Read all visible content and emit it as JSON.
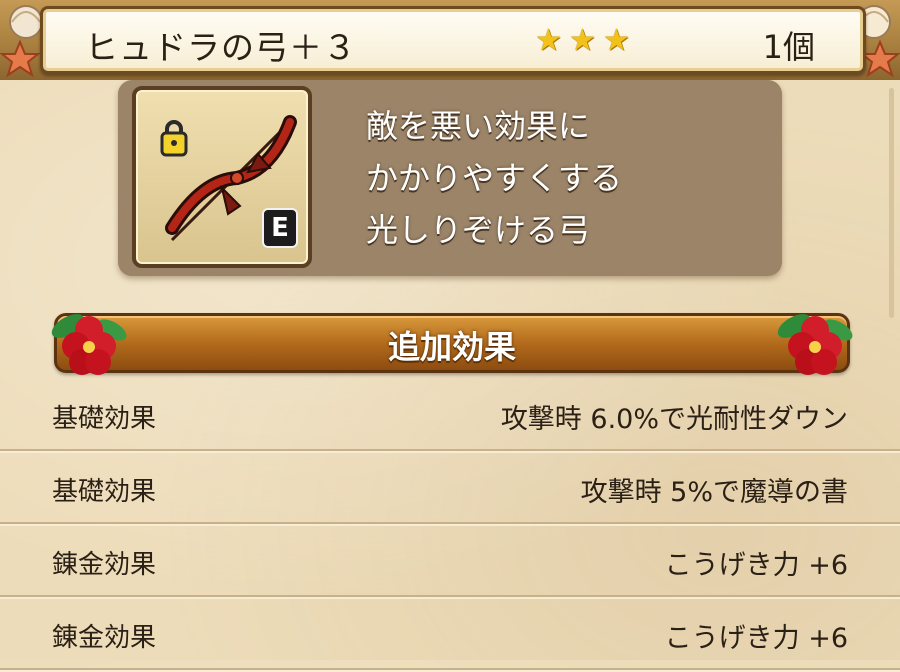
{
  "header": {
    "item_name": "ヒュドラの弓＋３",
    "stars": [
      "★",
      "★",
      "★"
    ],
    "count": "1個"
  },
  "item": {
    "equip_badge": "E",
    "description": [
      "敵を悪い効果に",
      "かかりやすくする",
      "光しりぞける弓"
    ]
  },
  "section": {
    "title": "追加効果"
  },
  "effects": [
    {
      "label": "基礎効果",
      "value": "攻撃時  6.0%で光耐性ダウン"
    },
    {
      "label": "基礎効果",
      "value": "攻撃時  5%で魔導の書"
    },
    {
      "label": "錬金効果",
      "value": "こうげき力  +6"
    },
    {
      "label": "錬金効果",
      "value": "こうげき力  +6"
    }
  ],
  "colors": {
    "star": "#f2c21b",
    "banner": "#b36b1c",
    "card": "#9b8468"
  },
  "icons": [
    "lock-icon",
    "bow-icon",
    "seashell-icon",
    "hibiscus-icon",
    "star-icon"
  ]
}
